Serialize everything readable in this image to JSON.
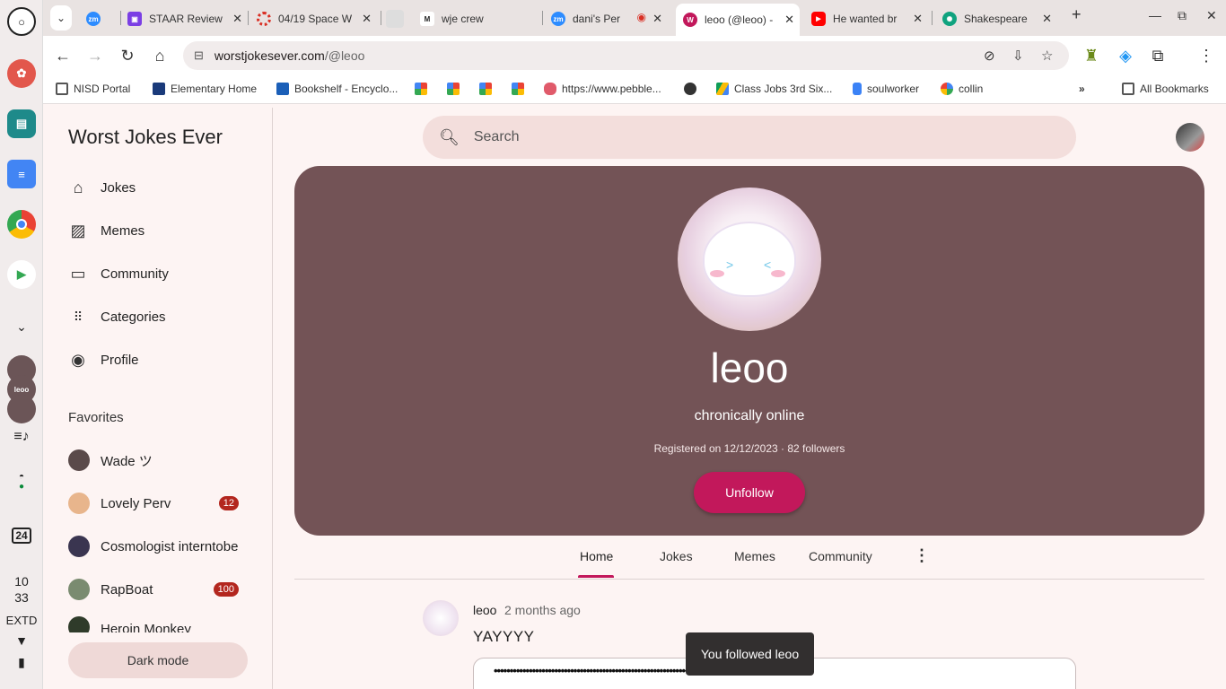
{
  "shelf": {
    "time_hour": "10",
    "time_min": "33",
    "extd": "EXTD",
    "calendar_day": "24",
    "avatar_labels": [
      "leoo"
    ]
  },
  "tabs": [
    {
      "title": "",
      "favicon": "zoom-icon",
      "color": "#2d8cff"
    },
    {
      "title": "STAAR Review",
      "favicon": "classroom-icon",
      "color": "#7b3fe4"
    },
    {
      "title": "04/19 Space W",
      "favicon": "spinner-icon",
      "color": "#d93025"
    },
    {
      "title": "",
      "favicon": "blank-icon",
      "color": "#d0d0d0"
    },
    {
      "title": "wje crew",
      "favicon": "gmail-icon",
      "color": "#222222"
    },
    {
      "title": "dani's Per",
      "favicon": "zoom-icon",
      "color": "#2d8cff"
    },
    {
      "title": "leoo (@leoo) -",
      "favicon": "w-icon",
      "color": "#c2185b",
      "active": true
    },
    {
      "title": "He wanted br",
      "favicon": "youtube-icon",
      "color": "#ff0000"
    },
    {
      "title": "Shakespeare",
      "favicon": "chatgpt-icon",
      "color": "#10a37f"
    }
  ],
  "omnibox": {
    "host": "worstjokesever.com",
    "path": "/@leoo"
  },
  "bookmarks": [
    {
      "label": "NISD Portal",
      "icon": "folder-icon"
    },
    {
      "label": "Elementary Home",
      "icon": "school-icon"
    },
    {
      "label": "Bookshelf - Encyclo...",
      "icon": "book-icon"
    },
    {
      "label": "",
      "icon": "pinwheel-icon"
    },
    {
      "label": "",
      "icon": "pinwheel-icon"
    },
    {
      "label": "",
      "icon": "pinwheel-icon"
    },
    {
      "label": "",
      "icon": "pinwheel-icon"
    },
    {
      "label": "https://www.pebble...",
      "icon": "pebble-icon"
    },
    {
      "label": "",
      "icon": "globe-icon"
    },
    {
      "label": "Class Jobs 3rd Six...",
      "icon": "drive-icon"
    },
    {
      "label": "soulworker",
      "icon": "lock-icon"
    },
    {
      "label": "collin",
      "icon": "google-icon"
    }
  ],
  "all_bookmarks": "All Bookmarks",
  "site": {
    "title": "Worst Jokes Ever",
    "nav": [
      {
        "label": "Jokes",
        "icon": "home-icon"
      },
      {
        "label": "Memes",
        "icon": "image-gallery-icon"
      },
      {
        "label": "Community",
        "icon": "forum-icon"
      },
      {
        "label": "Categories",
        "icon": "grid-icon"
      },
      {
        "label": "Profile",
        "icon": "account-circle-icon"
      }
    ],
    "favorites_heading": "Favorites",
    "favorites": [
      {
        "name": "Wade ツ",
        "badge": "",
        "color": "#5a4a4a"
      },
      {
        "name": "Lovely Perv",
        "badge": "12",
        "color": "#e8b58c"
      },
      {
        "name": "Cosmologist interntobe",
        "badge": "",
        "color": "#3a3550"
      },
      {
        "name": "RapBoat",
        "badge": "100",
        "color": "#7a8b70"
      },
      {
        "name": "Heroin Monkey",
        "badge": "",
        "color": "#2f3b2a"
      }
    ],
    "dark_mode": "Dark mode",
    "search_placeholder": "Search"
  },
  "profile": {
    "username": "leoo",
    "bio": "chronically online",
    "meta": "Registered on 12/12/2023 · 82 followers",
    "unfollow": "Unfollow",
    "tabs": [
      "Home",
      "Jokes",
      "Memes",
      "Community"
    ],
    "active_tab": "Home"
  },
  "post": {
    "user": "leoo",
    "time": "2 months ago",
    "text": "YAYYYY",
    "card_dots": "••••••••••••••••••••••••••••••••••••••••••••••••••••••••••••••••••••••••••••••••••••••••••••"
  },
  "toast": "You followed leoo",
  "colors": {
    "accent": "#c2185b",
    "hero_bg": "#735356",
    "page_bg": "#fdf4f3",
    "badge": "#b3261e"
  }
}
